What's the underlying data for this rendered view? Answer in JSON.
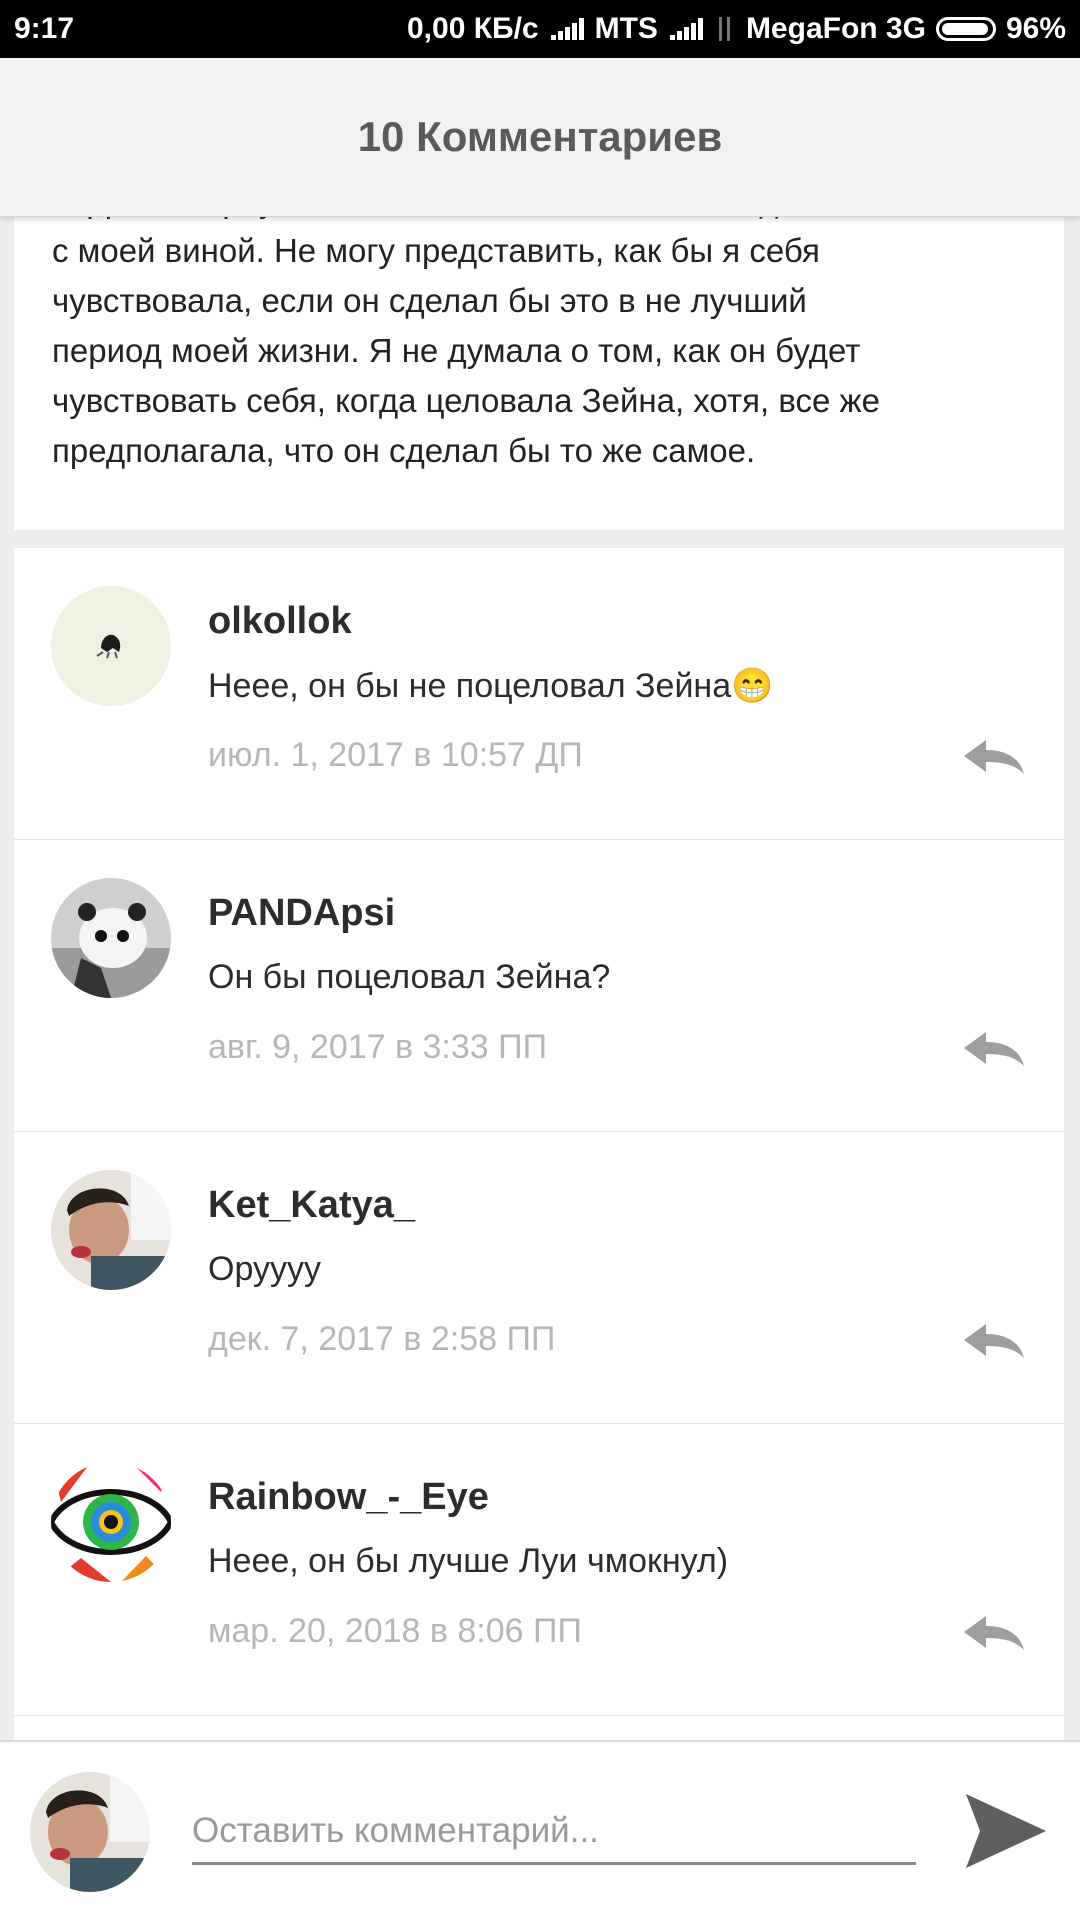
{
  "status_bar": {
    "time": "9:17",
    "network_speed": "0,00 КБ/с",
    "carrier1": "MTS",
    "carrier2": "MegaFon 3G",
    "battery": "96%",
    "icons": [
      "signal-icon",
      "data-arrows-icon",
      "battery-icon"
    ]
  },
  "header": {
    "title": "10 Комментариев"
  },
  "post": {
    "text": "Гарри повернулся ко мне спиной, оставив наедине\nс моей виной. Не могу представить, как бы я себя\nчувствовала, если он сделал бы это в не лучший\nпериод моей жизни. Я не думала о том, как он будет\nчувствовать себя, когда целовала Зейна, хотя, все же\nпредполагала, что он сделал бы то же самое."
  },
  "comments": [
    {
      "author": "olkollok",
      "text": "Неее, он бы не поцеловал Зейна😁",
      "date": "июл. 1, 2017 в 10:57 ДП"
    },
    {
      "author": "PANDApsi",
      "text": "Он бы поцеловал Зейна?",
      "date": "авг. 9, 2017 в 3:33 ПП"
    },
    {
      "author": "Ket_Katya_",
      "text": "Оруууу",
      "date": "дек. 7, 2017 в 2:58 ПП"
    },
    {
      "author": "Rainbow_-_Eye",
      "text": "Неее, он бы лучше Луи чмокнул)",
      "date": "мар. 20, 2018 в 8:06 ПП"
    }
  ],
  "compose": {
    "placeholder": "Оставить комментарий...",
    "send_icon": "send-icon"
  },
  "colors": {
    "background": "#eeeeee",
    "header_bg": "#f2f2f2",
    "title_text": "#5a5a5a",
    "date_text": "#b6b6b6",
    "reply_icon": "#9e9e9e"
  }
}
